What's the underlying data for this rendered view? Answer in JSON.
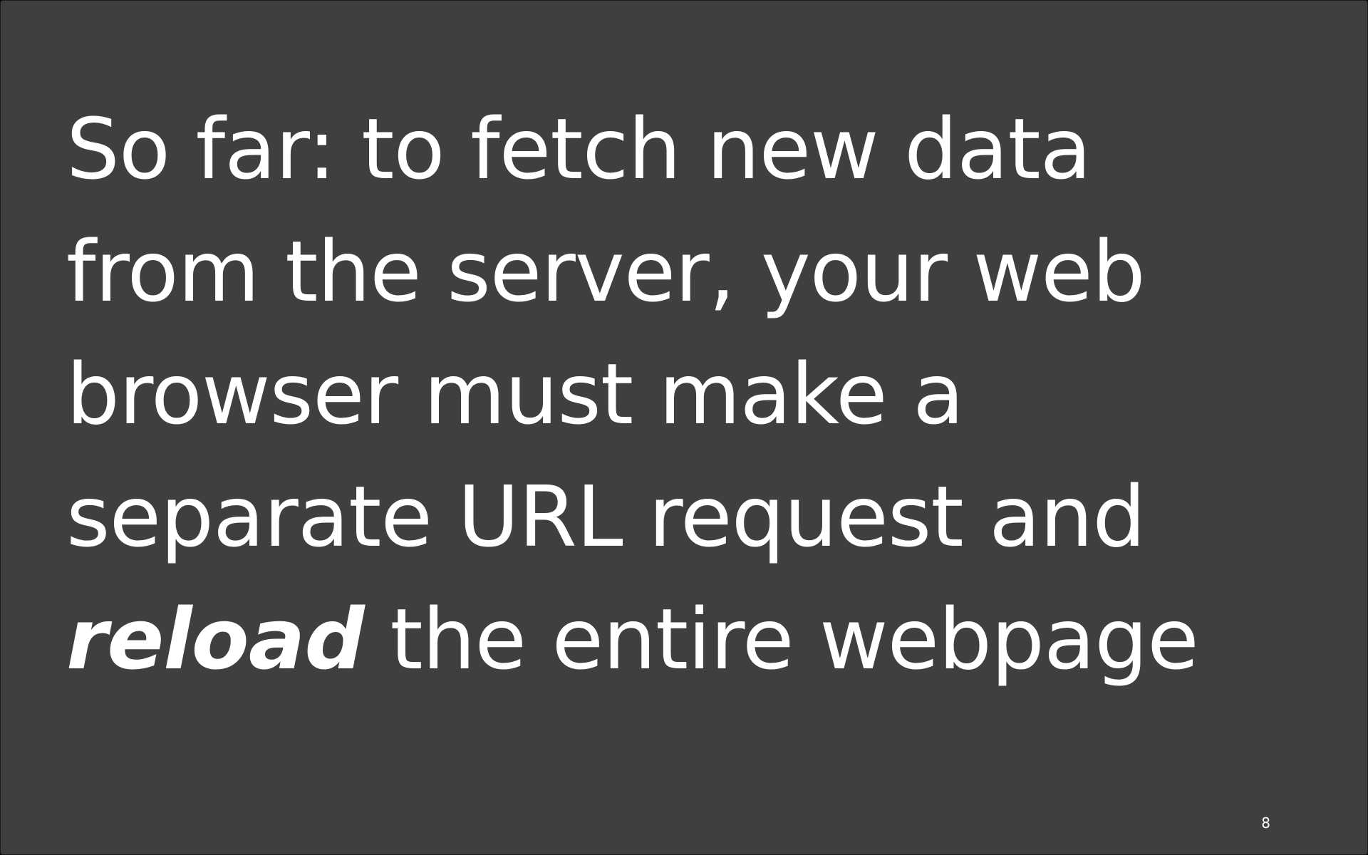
{
  "slide": {
    "background_color": "#3f3f3f",
    "text_color": "#ffffff",
    "lines": {
      "line1": "So far: to fetch new data",
      "line2": "from the server, your web",
      "line3": "browser must make a",
      "line4": "separate URL request and",
      "line5_emphasis": "reload",
      "line5_rest": " the entire webpage"
    },
    "page_number": "8"
  }
}
